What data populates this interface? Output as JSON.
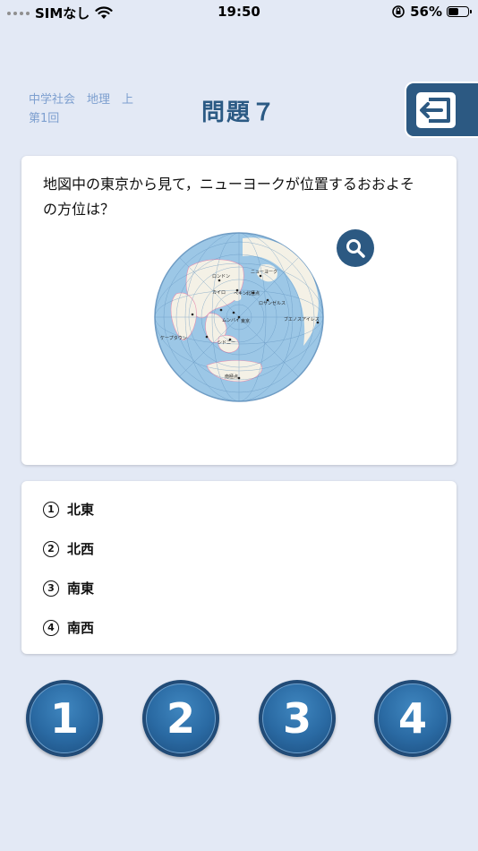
{
  "status_bar": {
    "carrier": "SIMなし",
    "time": "19:50",
    "battery_percent": "56%",
    "battery_level": 0.56,
    "icons": [
      "signal-dots-icon",
      "wifi-icon",
      "orientation-lock-icon",
      "battery-icon"
    ]
  },
  "header": {
    "subject_line1": "中学社会　地理　上",
    "subject_line2": "第1回",
    "title": "問題７",
    "exit_icon": "exit-icon"
  },
  "question": {
    "text_line1": "地図中の東京から見て，ニューヨークが位置するおおよそ",
    "text_line2": "の方位は？",
    "zoom_icon": "magnifier-icon",
    "map": {
      "type": "azimuthal-equidistant-world-map",
      "labels": [
        "ロンドン",
        "ペキン",
        "ニューヨーク",
        "北極点",
        "ロサンゼルス",
        "カイロ",
        "ムンバイ",
        "東京",
        "ケープタウン",
        "シドニー",
        "ブエノスアイレス",
        "南極点"
      ]
    }
  },
  "options": [
    {
      "num": "1",
      "label": "北東"
    },
    {
      "num": "2",
      "label": "北西"
    },
    {
      "num": "3",
      "label": "南東"
    },
    {
      "num": "4",
      "label": "南西"
    }
  ],
  "answer_buttons": [
    "1",
    "2",
    "3",
    "4"
  ],
  "colors": {
    "background": "#e3e9f5",
    "accent": "#2c5982",
    "subject_text": "#7d9fcf",
    "ocean": "#9cc7e6",
    "land": "#f4f1e6"
  }
}
